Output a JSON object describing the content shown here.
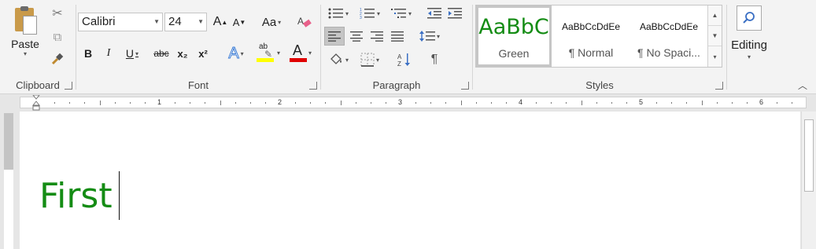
{
  "clipboard": {
    "group_label": "Clipboard",
    "paste_label": "Paste"
  },
  "font": {
    "group_label": "Font",
    "font_name": "Calibri",
    "font_size": "24",
    "change_case_label": "Aa",
    "bold_label": "B",
    "italic_label": "I",
    "underline_label": "U",
    "strikethrough_label": "abc",
    "subscript_label": "x₂",
    "superscript_label": "x²",
    "grow_font_label": "A",
    "shrink_font_label": "A",
    "text_effects_label": "A",
    "highlight_label": "ab",
    "font_color_label": "A",
    "highlight_color": "#ffff00",
    "font_color": "#e00000"
  },
  "paragraph": {
    "group_label": "Paragraph",
    "show_marks_label": "¶"
  },
  "styles": {
    "group_label": "Styles",
    "items": [
      {
        "sample": "AaBbC",
        "name": "Green",
        "selected": true,
        "color": "#148c14"
      },
      {
        "sample": "AaBbCcDdEe",
        "name": "¶ Normal",
        "selected": false
      },
      {
        "sample": "AaBbCcDdEe",
        "name": "¶ No Spaci...",
        "selected": false
      }
    ]
  },
  "editing": {
    "label": "Editing"
  },
  "ruler": {
    "numbers": [
      "1",
      "2",
      "3",
      "4",
      "5",
      "6"
    ],
    "tab_selector": "L"
  },
  "document": {
    "text": "First",
    "text_color": "#148c14"
  }
}
